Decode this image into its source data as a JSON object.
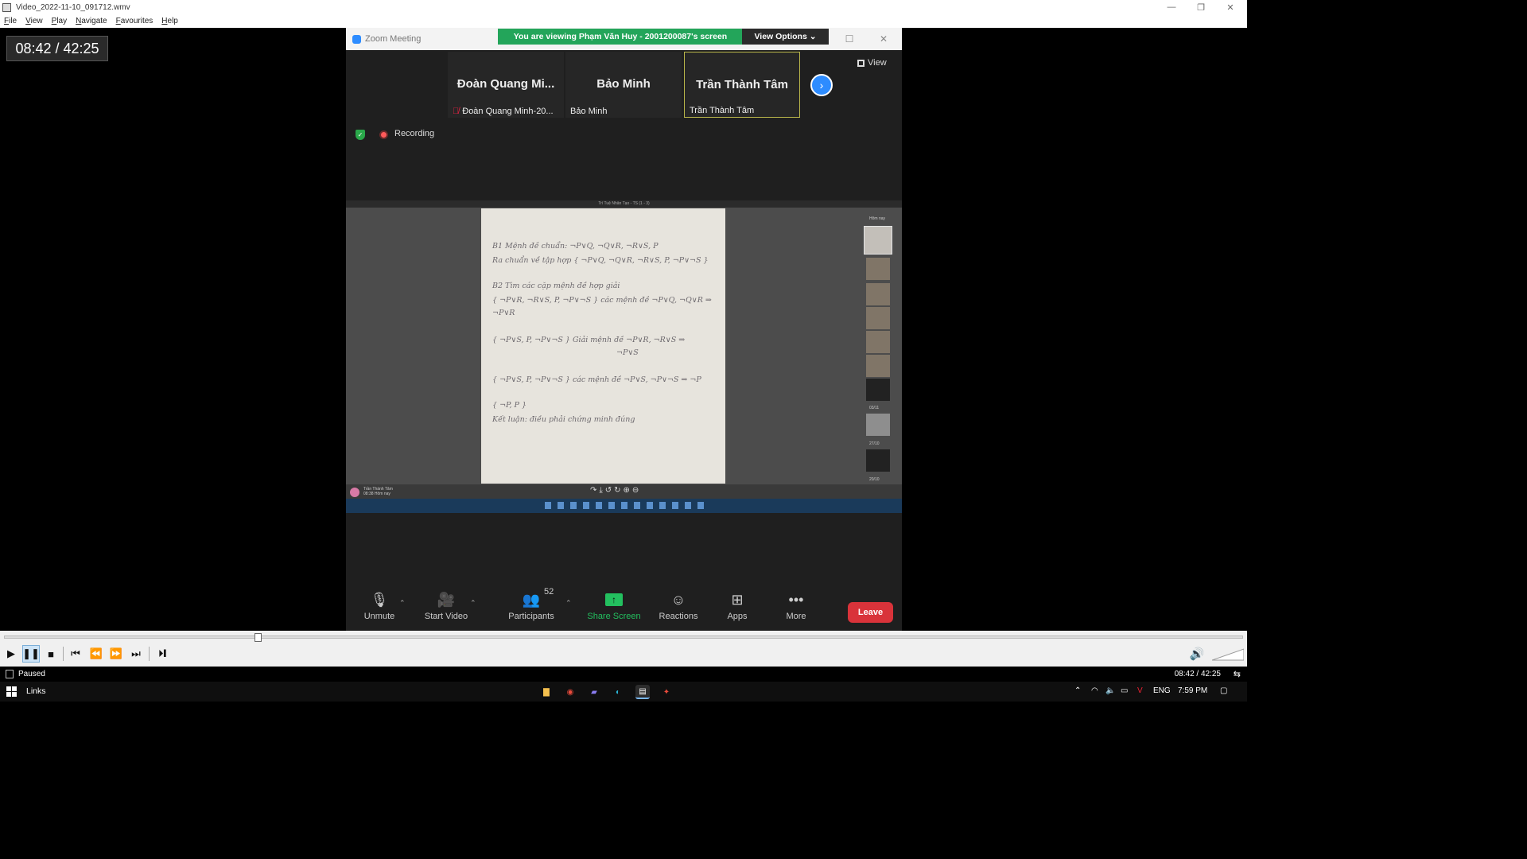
{
  "window": {
    "title": "Video_2022-11-10_091712.wmv"
  },
  "menu": [
    "File",
    "View",
    "Play",
    "Navigate",
    "Favourites",
    "Help"
  ],
  "osd": {
    "time": "08:42 / 42:25"
  },
  "zoom": {
    "window_title": "Zoom Meeting",
    "banner": "You are viewing Phạm Văn Huy - 2001200087's screen",
    "view_options": "View Options ⌄",
    "view_label": "View",
    "recording_label": "Recording",
    "participants": [
      {
        "display": "Đoàn Quang Mi...",
        "label": "Đoàn Quang Minh-20...",
        "muted": true
      },
      {
        "display": "Bảo Minh",
        "label": "Bảo Minh",
        "muted": false
      },
      {
        "display": "Trần Thành Tâm",
        "label": "Trần Thành Tâm",
        "muted": false
      }
    ],
    "shared_screen": {
      "window_title": "Trí Tuệ Nhân Tạo - TS (1 - 3)",
      "sidebar_header": "Hôm nay",
      "dates": [
        "03/11",
        "27/10",
        "20/10"
      ],
      "sender_name": "Trần Thành Tâm",
      "sender_time": "08:38 Hôm nay",
      "handwriting": [
        "B1 Mệnh đề chuẩn: ¬P∨Q, ¬Q∨R, ¬R∨S, P",
        "Ra chuẩn về tập hợp { ¬P∨Q, ¬Q∨R, ¬R∨S, P, ¬P∨¬S }",
        "B2 Tìm các cặp mệnh đề hợp giải",
        "{ ¬P∨R, ¬R∨S, P, ¬P∨¬S } các mệnh đề ¬P∨Q, ¬Q∨R ⇒",
        "¬P∨R",
        "{ ¬P∨S, P, ¬P∨¬S } Giải mệnh đề ¬P∨R, ¬R∨S ⇒",
        "¬P∨S",
        "{ ¬P∨S, P, ¬P∨¬S } các mệnh đề ¬P∨S, ¬P∨¬S ⇒ ¬P",
        "{ ¬P, P }",
        "Kết luận: điều phải chứng minh đúng"
      ]
    },
    "toolbar": {
      "unmute": "Unmute",
      "start_video": "Start Video",
      "participants": "Participants",
      "participants_count": "52",
      "share_screen": "Share Screen",
      "reactions": "Reactions",
      "apps": "Apps",
      "more": "More",
      "leave": "Leave"
    }
  },
  "player": {
    "status": "Paused",
    "time": "08:42 / 42:25",
    "progress": 0.205
  },
  "taskbar": {
    "links": "Links",
    "language": "ENG",
    "clock": "7:59 PM"
  },
  "colors": {
    "zoom_blue": "#2d8cff",
    "banner_green": "#23a55a",
    "share_green": "#23c05f",
    "leave_red": "#d9333a"
  }
}
